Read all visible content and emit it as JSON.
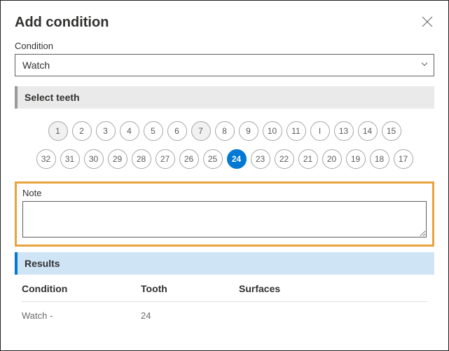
{
  "dialog": {
    "title": "Add condition",
    "close_aria": "Close"
  },
  "condition": {
    "label": "Condition",
    "value": "Watch"
  },
  "teeth": {
    "section_title": "Select teeth",
    "upper": [
      "1",
      "2",
      "3",
      "4",
      "5",
      "6",
      "7",
      "8",
      "9",
      "10",
      "11",
      "I",
      "13",
      "14",
      "15"
    ],
    "lower": [
      "32",
      "31",
      "30",
      "29",
      "28",
      "27",
      "26",
      "25",
      "24",
      "23",
      "22",
      "21",
      "20",
      "19",
      "18",
      "17"
    ],
    "dim": [
      "1",
      "7"
    ],
    "selected": [
      "24"
    ]
  },
  "note": {
    "label": "Note",
    "value": ""
  },
  "results": {
    "section_title": "Results",
    "columns": {
      "condition": "Condition",
      "tooth": "Tooth",
      "surfaces": "Surfaces"
    },
    "rows": [
      {
        "condition": "Watch -",
        "tooth": "24",
        "surfaces": ""
      }
    ]
  }
}
